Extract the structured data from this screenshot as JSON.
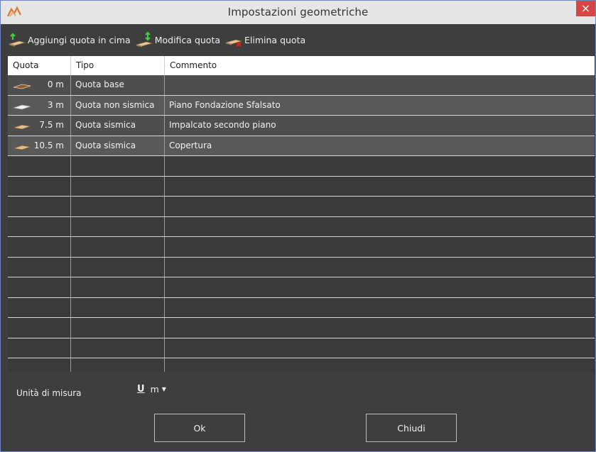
{
  "window": {
    "title": "Impostazioni geometriche",
    "close_glyph": "×",
    "app_icon": "app-logo-icon"
  },
  "toolbar": {
    "add_label": "Aggiungi quota in cima",
    "edit_label": "Modifica quota",
    "delete_label": "Elimina quota"
  },
  "grid": {
    "headers": [
      "Quota",
      "Tipo",
      "Commento"
    ],
    "rows": [
      {
        "quota": "0 m",
        "tipo": "Quota base",
        "commento": ""
      },
      {
        "quota": "3 m",
        "tipo": "Quota non sismica",
        "commento": "Piano Fondazione Sfalsato"
      },
      {
        "quota": "7.5 m",
        "tipo": "Quota sismica",
        "commento": "Impalcato secondo piano"
      },
      {
        "quota": "10.5 m",
        "tipo": "Quota sismica",
        "commento": "Copertura"
      }
    ]
  },
  "units": {
    "label": "Unità di misura",
    "icon_glyph": "U",
    "selected": "m"
  },
  "buttons": {
    "ok": "Ok",
    "close": "Chiudi"
  },
  "colors": {
    "background": "#3e3e3e",
    "titlebar": "#e6e6e6",
    "close": "#d64545",
    "slab": "#d9b98a"
  }
}
